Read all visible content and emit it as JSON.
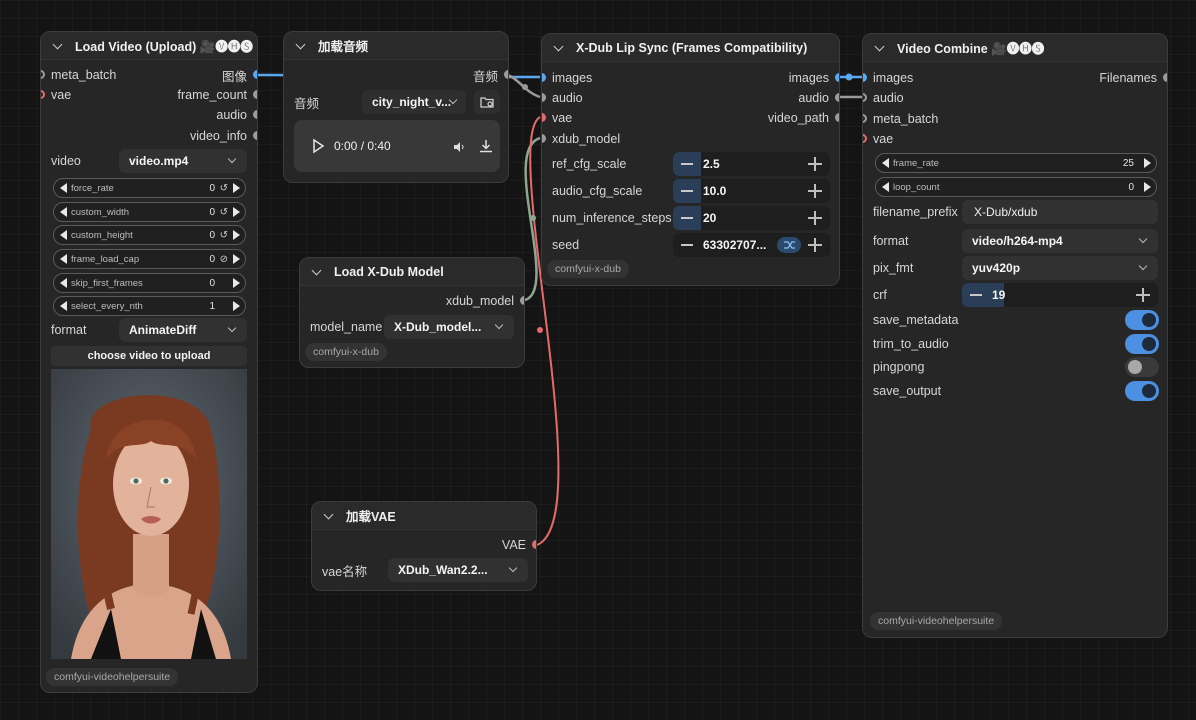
{
  "load_video": {
    "title": "Load Video (Upload) 🎥🅥🅗🅢",
    "inputs": [
      "meta_batch",
      "vae"
    ],
    "outputs": [
      "图像",
      "frame_count",
      "audio",
      "video_info"
    ],
    "video_label": "video",
    "video_value": "video.mp4",
    "params": [
      {
        "name": "force_rate",
        "value": "0",
        "symbol": "↺"
      },
      {
        "name": "custom_width",
        "value": "0",
        "symbol": "↺"
      },
      {
        "name": "custom_height",
        "value": "0",
        "symbol": "↺"
      },
      {
        "name": "frame_load_cap",
        "value": "0",
        "symbol": "⊘"
      },
      {
        "name": "skip_first_frames",
        "value": "0",
        "symbol": ""
      },
      {
        "name": "select_every_nth",
        "value": "1",
        "symbol": ""
      }
    ],
    "format_label": "format",
    "format_value": "AnimateDiff",
    "upload_button": "choose video to upload",
    "footer": "comfyui-videohelpersuite"
  },
  "load_audio": {
    "title": "加载音频",
    "output": "音频",
    "audio_label": "音频",
    "audio_value": "city_night_v...",
    "time": "0:00 / 0:40"
  },
  "lip_sync": {
    "title": "X-Dub Lip Sync (Frames Compatibility)",
    "inputs": [
      "images",
      "audio",
      "vae",
      "xdub_model"
    ],
    "outputs": [
      "images",
      "audio",
      "video_path"
    ],
    "params": [
      {
        "name": "ref_cfg_scale",
        "value": "2.5"
      },
      {
        "name": "audio_cfg_scale",
        "value": "10.0"
      },
      {
        "name": "num_inference_steps",
        "value": "20"
      }
    ],
    "seed_label": "seed",
    "seed_value": "63302707...",
    "footer": "comfyui-x-dub"
  },
  "load_model": {
    "title": "Load X-Dub Model",
    "output": "xdub_model",
    "model_label": "model_name",
    "model_value": "X-Dub_model...",
    "footer": "comfyui-x-dub"
  },
  "load_vae": {
    "title": "加载VAE",
    "output": "VAE",
    "vae_label": "vae名称",
    "vae_value": "XDub_Wan2.2..."
  },
  "video_combine": {
    "title": "Video Combine 🎥🅥🅗🅢",
    "inputs": [
      "images",
      "audio",
      "meta_batch",
      "vae"
    ],
    "output": "Filenames",
    "frame_rate_label": "frame_rate",
    "frame_rate_value": "25",
    "loop_count_label": "loop_count",
    "loop_count_value": "0",
    "filename_prefix_label": "filename_prefix",
    "filename_prefix_value": "X-Dub/xdub",
    "format_label": "format",
    "format_value": "video/h264-mp4",
    "pix_fmt_label": "pix_fmt",
    "pix_fmt_value": "yuv420p",
    "crf_label": "crf",
    "crf_value": "19",
    "toggles": [
      {
        "name": "save_metadata",
        "on": true
      },
      {
        "name": "trim_to_audio",
        "on": true
      },
      {
        "name": "pingpong",
        "on": false
      },
      {
        "name": "save_output",
        "on": true
      }
    ],
    "footer": "comfyui-videohelpersuite"
  },
  "colors": {
    "image_wire": "#5aa9f0",
    "vae_wire": "#e56a6a",
    "model_wire": "#8fa58f",
    "audio_wire": "#9a9a9a",
    "toggle_on": "#4d8fe0"
  }
}
